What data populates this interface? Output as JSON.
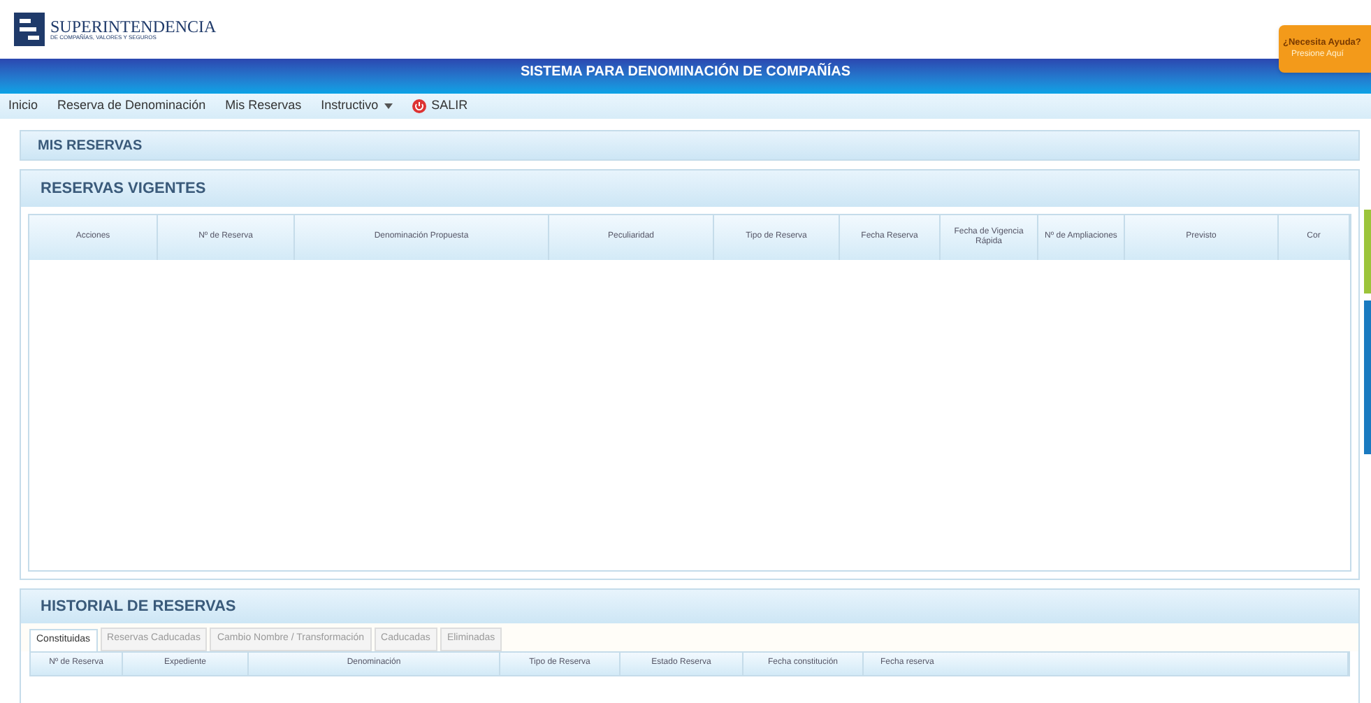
{
  "header": {
    "logo_text": "SUPERINTENDENCIA",
    "logo_subtext": "DE COMPAÑÍAS, VALORES Y SEGUROS",
    "help_title": "¿Necesita Ayuda?",
    "help_subtitle": "Presione Aquí"
  },
  "title_bar": {
    "title": "SISTEMA PARA DENOMINACIÓN DE COMPAÑÍAS"
  },
  "menu": [
    {
      "label": "Inicio",
      "kind": "link"
    },
    {
      "label": "Reserva de Denominación",
      "kind": "link"
    },
    {
      "label": "Mis Reservas",
      "kind": "link"
    },
    {
      "label": "Instructivo",
      "kind": "dropdown"
    },
    {
      "label": "SALIR",
      "kind": "exit"
    }
  ],
  "page_title": "MIS RESERVAS",
  "current_reservations": {
    "title": "RESERVAS VIGENTES",
    "columns": [
      "Acciones",
      "Nº de Reserva",
      "Denominación Propuesta",
      "Peculiaridad",
      "Tipo de Reserva",
      "Fecha Reserva",
      "Fecha de Vigencia Rápida",
      "Nº de Ampliaciones",
      "Previsto",
      "Cor"
    ]
  },
  "history": {
    "title": "HISTORIAL DE RESERVAS",
    "tabs": [
      {
        "label": "Constituidas",
        "selected": true
      },
      {
        "label": "Reservas Caducadas",
        "selected": false
      },
      {
        "label": "Cambio Nombre / Transformación",
        "selected": false
      },
      {
        "label": "Caducadas",
        "selected": false
      },
      {
        "label": "Eliminadas",
        "selected": false
      }
    ],
    "columns": [
      "Nº de Reserva",
      "Expediente",
      "Denominación",
      "Tipo de Reserva",
      "Estado Reserva",
      "Fecha constitución",
      "Fecha reserva"
    ]
  }
}
